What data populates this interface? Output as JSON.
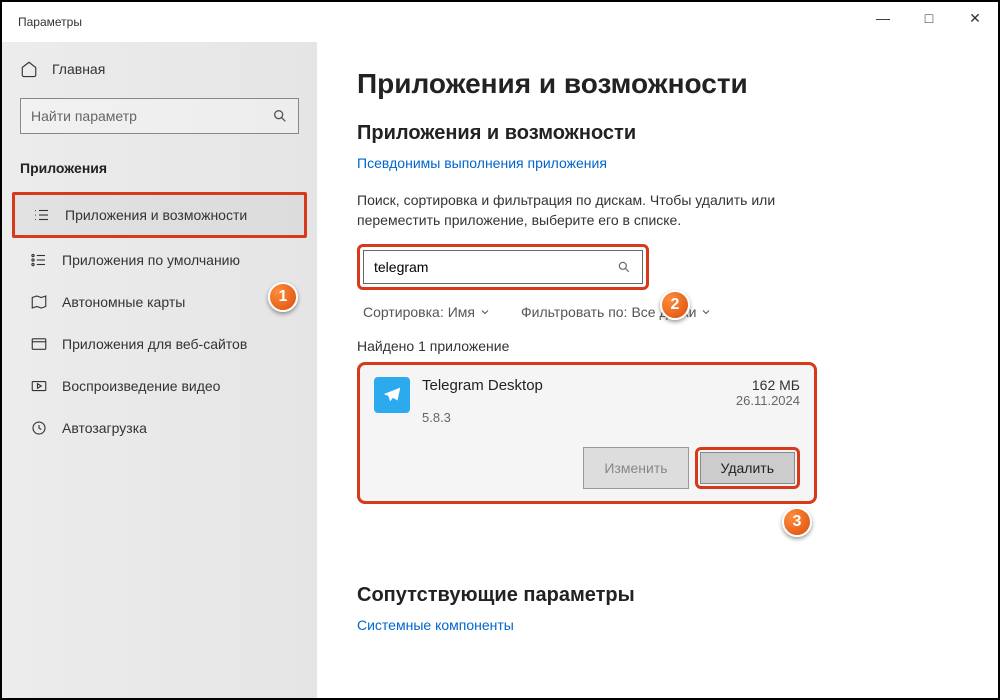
{
  "window": {
    "title": "Параметры",
    "minimize": "—",
    "maximize": "□",
    "close": "✕"
  },
  "sidebar": {
    "home": "Главная",
    "search_placeholder": "Найти параметр",
    "section": "Приложения",
    "items": [
      {
        "label": "Приложения и возможности",
        "selected": true
      },
      {
        "label": "Приложения по умолчанию"
      },
      {
        "label": "Автономные карты"
      },
      {
        "label": "Приложения для веб-сайтов"
      },
      {
        "label": "Воспроизведение видео"
      },
      {
        "label": "Автозагрузка"
      }
    ]
  },
  "main": {
    "title": "Приложения и возможности",
    "subtitle": "Приложения и возможности",
    "aliases_link": "Псевдонимы выполнения приложения",
    "help_text": "Поиск, сортировка и фильтрация по дискам. Чтобы удалить или переместить приложение, выберите его в списке.",
    "search_value": "telegram",
    "sort_label": "Сортировка:",
    "sort_value": "Имя",
    "filter_label": "Фильтровать по:",
    "filter_value": "Все диски",
    "found_text": "Найдено 1 приложение",
    "app": {
      "name": "Telegram Desktop",
      "version": "5.8.3",
      "size": "162 МБ",
      "date": "26.11.2024",
      "modify": "Изменить",
      "uninstall": "Удалить"
    },
    "related_title": "Сопутствующие параметры",
    "related_link": "Системные компоненты"
  },
  "badges": {
    "b1": "1",
    "b2": "2",
    "b3": "3"
  }
}
